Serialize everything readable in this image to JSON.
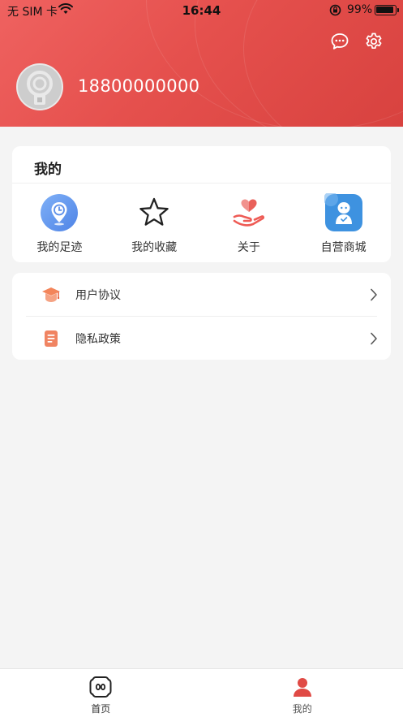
{
  "status_bar": {
    "carrier": "无 SIM 卡",
    "time": "16:44",
    "battery": "99%"
  },
  "header": {
    "phone": "18800000000",
    "icons": [
      "message-icon",
      "settings-icon"
    ]
  },
  "mine": {
    "title": "我的",
    "items": [
      {
        "label": "我的足迹",
        "icon": "footprint-icon"
      },
      {
        "label": "我的收藏",
        "icon": "star-icon"
      },
      {
        "label": "关于",
        "icon": "heart-hand-icon"
      },
      {
        "label": "自营商城",
        "icon": "robot-icon"
      }
    ]
  },
  "menu": {
    "items": [
      {
        "label": "用户协议",
        "icon": "graduation-cap-icon"
      },
      {
        "label": "隐私政策",
        "icon": "document-icon"
      }
    ]
  },
  "tabbar": {
    "tabs": [
      {
        "label": "首页",
        "icon": "home-icon"
      },
      {
        "label": "我的",
        "icon": "profile-icon"
      }
    ],
    "active": "我的"
  },
  "colors": {
    "brand": "#e5504d",
    "background": "#f4f4f4"
  }
}
